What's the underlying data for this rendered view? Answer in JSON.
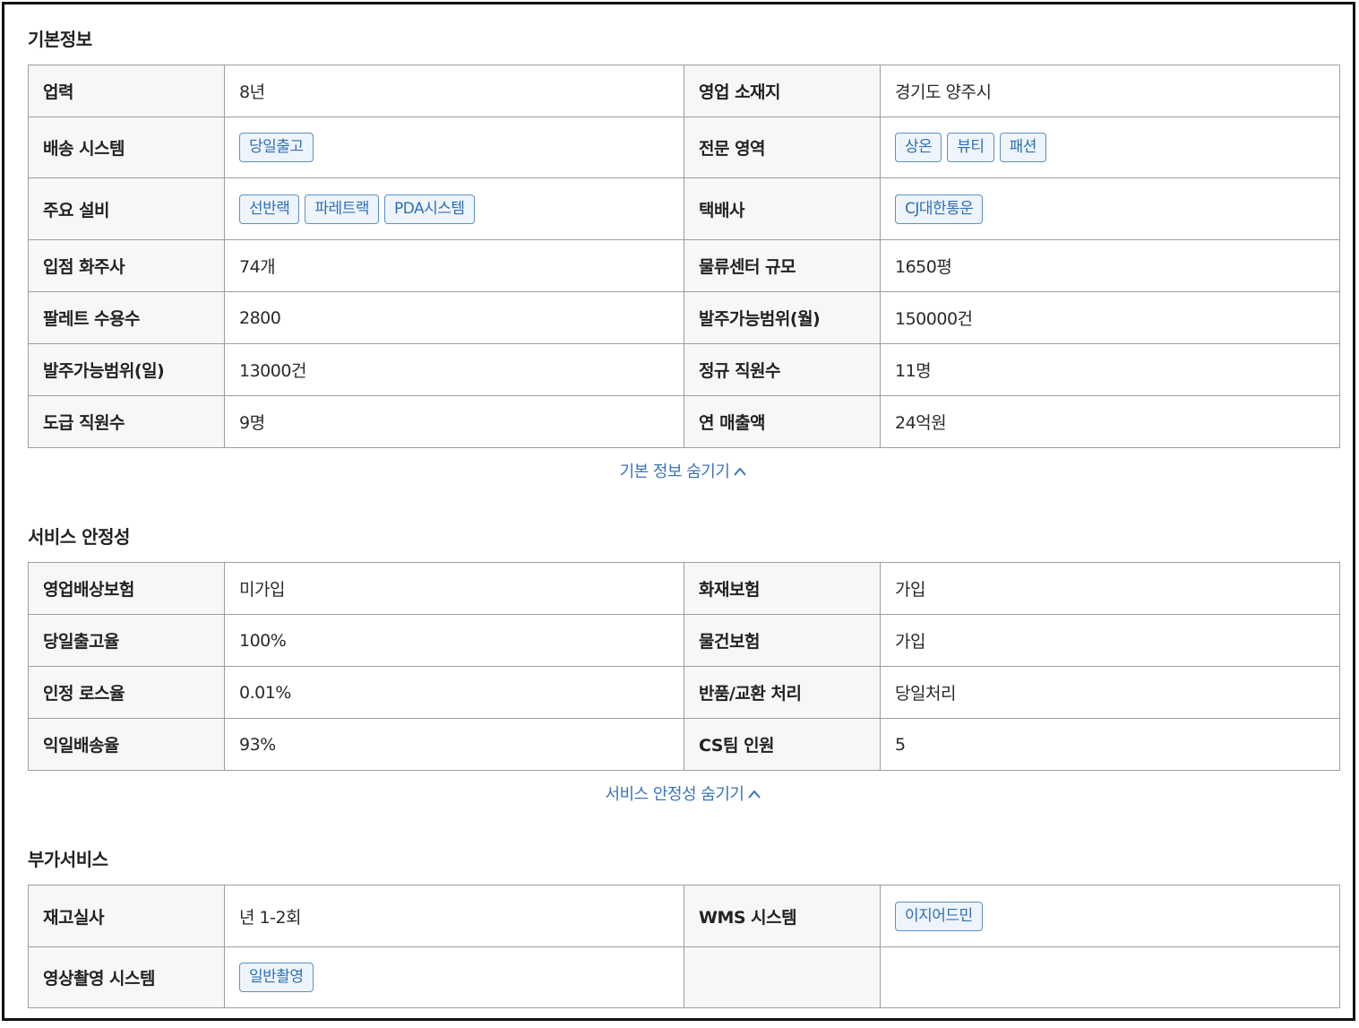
{
  "basic_info": {
    "title": "기본정보",
    "toggle_label": "기본 정보 숨기기",
    "career_label": "업력",
    "career_value": "8년",
    "location_label": "영업 소재지",
    "location_value": "경기도 양주시",
    "delivery_label": "배송 시스템",
    "delivery_tags": [
      "당일출고"
    ],
    "specialty_label": "전문 영역",
    "specialty_tags": [
      "상온",
      "뷰티",
      "패션"
    ],
    "equipment_label": "주요 설비",
    "equipment_tags": [
      "선반랙",
      "파레트랙",
      "PDA시스템"
    ],
    "courier_label": "택배사",
    "courier_tags": [
      "CJ대한통운"
    ],
    "shippers_label": "입점 화주사",
    "shippers_value": "74개",
    "center_size_label": "물류센터 규모",
    "center_size_value": "1650평",
    "pallet_label": "팔레트 수용수",
    "pallet_value": "2800",
    "monthly_label": "발주가능범위(월)",
    "monthly_value": "150000건",
    "daily_label": "발주가능범위(일)",
    "daily_value": "13000건",
    "fulltime_label": "정규 직원수",
    "fulltime_value": "11명",
    "contract_label": "도급 직원수",
    "contract_value": "9명",
    "revenue_label": "연 매출액",
    "revenue_value": "24억원"
  },
  "service_stability": {
    "title": "서비스 안정성",
    "toggle_label": "서비스 안정성 숨기기",
    "liability_label": "영업배상보험",
    "liability_value": "미가입",
    "fire_label": "화재보험",
    "fire_value": "가입",
    "sameday_label": "당일출고율",
    "sameday_value": "100%",
    "cargo_label": "물건보험",
    "cargo_value": "가입",
    "loss_label": "인정 로스율",
    "loss_value": "0.01%",
    "returns_label": "반품/교환 처리",
    "returns_value": "당일처리",
    "nextday_label": "익일배송율",
    "nextday_value": "93%",
    "cs_label": "CS팀 인원",
    "cs_value": "5"
  },
  "additional_services": {
    "title": "부가서비스",
    "inventory_label": "재고실사",
    "inventory_value": "년 1-2회",
    "wms_label": "WMS 시스템",
    "wms_tags": [
      "이지어드민"
    ],
    "video_label": "영상촬영 시스템",
    "video_tags": [
      "일반촬영"
    ]
  },
  "icons": {
    "toggle_chevron": "chevron-up-icon"
  },
  "colors": {
    "link": "#3b74b8",
    "tag_text": "#2f6fb5",
    "tag_border": "#5e8fc7",
    "border": "#9e9e9e",
    "key_bg": "#f7f7f7"
  }
}
